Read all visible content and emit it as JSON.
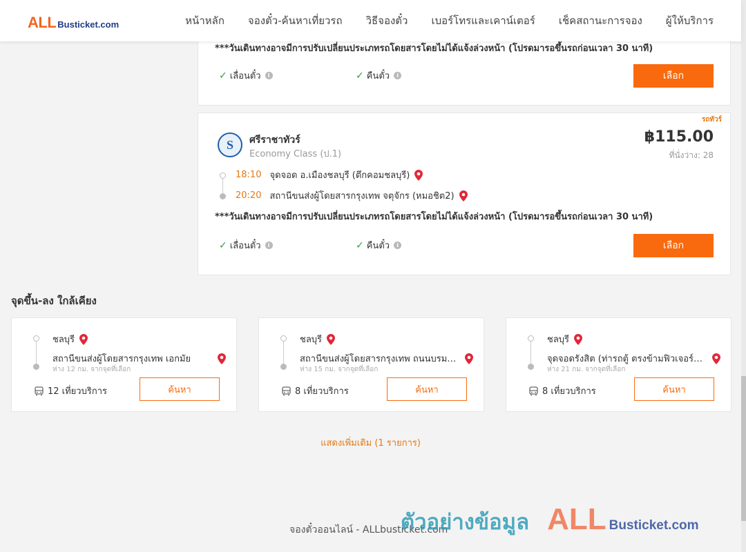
{
  "header": {
    "logo_all": "ALL",
    "logo_busticket": "Busticket.com",
    "nav": [
      "หน้าหลัก",
      "จองตั๋ว-ค้นหาเที่ยวรถ",
      "วิธีจองตั๋ว",
      "เบอร์โทรและเคาน์เตอร์",
      "เช็คสถานะการจอง",
      "ผู้ให้บริการ"
    ]
  },
  "trips": [
    {
      "note": "***วันเดินทางอาจมีการปรับเปลี่ยนประเภทรถโดยสารโดยไม่ได้แจ้งล่วงหน้า (โปรดมารอขึ้นรถก่อนเวลา 30 นาที)",
      "feature_1": "เลื่อนตั๋ว",
      "feature_2": "คืนตั๋ว",
      "select_label": "เลือก"
    },
    {
      "tag": "รถทัวร์",
      "operator": "ศรีราชาทัวร์",
      "bus_class": "Economy Class (ป.1)",
      "price": "฿115.00",
      "seats": "ที่นั่งว่าง: 28",
      "depart_time": "18:10",
      "depart_place": "จุดจอด อ.เมืองชลบุรี (ตึกคอมชลบุรี)",
      "arrive_time": "20:20",
      "arrive_place": "สถานีขนส่งผู้โดยสารกรุงเทพ จตุจักร (หมอชิต2)",
      "note": "***วันเดินทางอาจมีการปรับเปลี่ยนประเภทรถโดยสารโดยไม่ได้แจ้งล่วงหน้า (โปรดมารอขึ้นรถก่อนเวลา 30 นาที)",
      "feature_1": "เลื่อนตั๋ว",
      "feature_2": "คืนตั๋ว",
      "select_label": "เลือก"
    }
  ],
  "nearby": {
    "title": "จุดขึ้น-ลง ใกล้เคียง",
    "items": [
      {
        "from": "ชลบุรี",
        "to": "สถานีขนส่งผู้โดยสารกรุงเทพ เอกมัย",
        "distance": "ห่าง 12 กม. จากจุดที่เลือก",
        "trips": "12 เที่ยวบริการ",
        "button": "ค้นหา"
      },
      {
        "from": "ชลบุรี",
        "to": "สถานีขนส่งผู้โดยสารกรุงเทพ ถนนบรมราชชนนี (สายใต้ใหม่)",
        "distance": "ห่าง 15 กม. จากจุดที่เลือก",
        "trips": "8 เที่ยวบริการ",
        "button": "ค้นหา"
      },
      {
        "from": "ชลบุรี",
        "to": "จุดจอดรังสิต (ท่ารถตู้ ตรงข้ามฟิวเจอร์พาร์ค)",
        "distance": "ห่าง 21 กม. จากจุดที่เลือก",
        "trips": "8 เที่ยวบริการ",
        "button": "ค้นหา"
      }
    ],
    "more_label": "แสดงเพิ่มเติม (1 รายการ)"
  },
  "footer": "จองตั๋วออนไลน์ - ALLbusticket.com",
  "watermark": {
    "thai": "ตัวอย่างข้อมูล",
    "all": "ALL",
    "busticket": "Busticket.com"
  },
  "colors": {
    "accent": "#f96a0e",
    "time": "#e6780f",
    "check": "#2e9e3e",
    "pin": "#e0283a"
  }
}
